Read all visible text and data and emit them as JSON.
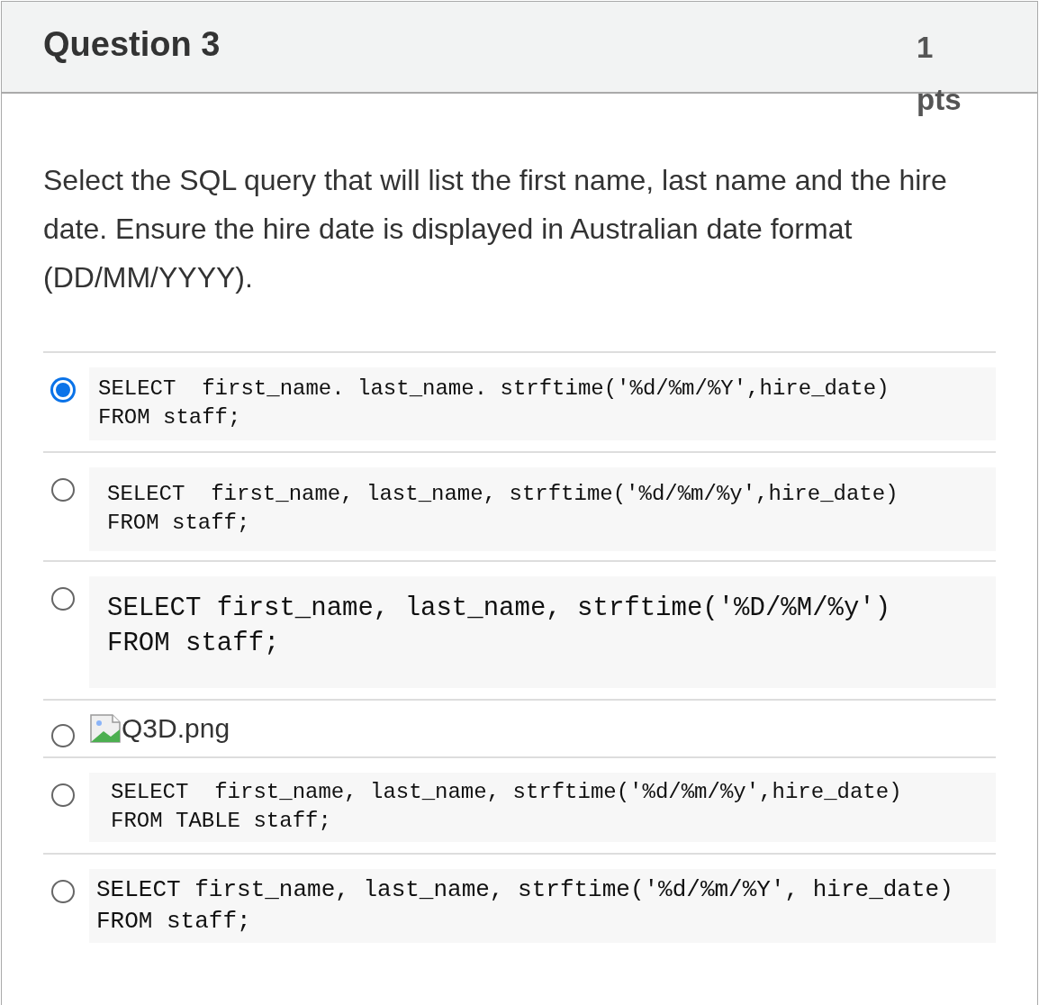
{
  "question": {
    "title": "Question 3",
    "points": "1 pts",
    "text": "Select the SQL query that will list the first name, last name and the hire date. Ensure the hire date is displayed in Australian date format (DD/MM/YYYY)."
  },
  "answers": [
    {
      "kind": "code",
      "selected": true,
      "lines": [
        "SELECT  first_name. last_name. strftime('%d/%m/%Y',hire_date)",
        "FROM staff;"
      ]
    },
    {
      "kind": "code",
      "selected": false,
      "lines": [
        "SELECT  first_name, last_name, strftime('%d/%m/%y',hire_date)",
        "FROM staff;"
      ]
    },
    {
      "kind": "code",
      "selected": false,
      "lines": [
        "SELECT first_name, last_name, strftime('%D/%M/%y')",
        "FROM staff;"
      ]
    },
    {
      "kind": "image",
      "selected": false,
      "alt": "Q3D.png"
    },
    {
      "kind": "code",
      "selected": false,
      "lines": [
        "SELECT  first_name, last_name, strftime('%d/%m/%y',hire_date)",
        "FROM TABLE staff;"
      ]
    },
    {
      "kind": "code",
      "selected": false,
      "lines": [
        "SELECT first_name, last_name, strftime('%d/%m/%Y', hire_date)",
        "FROM staff;"
      ]
    }
  ]
}
